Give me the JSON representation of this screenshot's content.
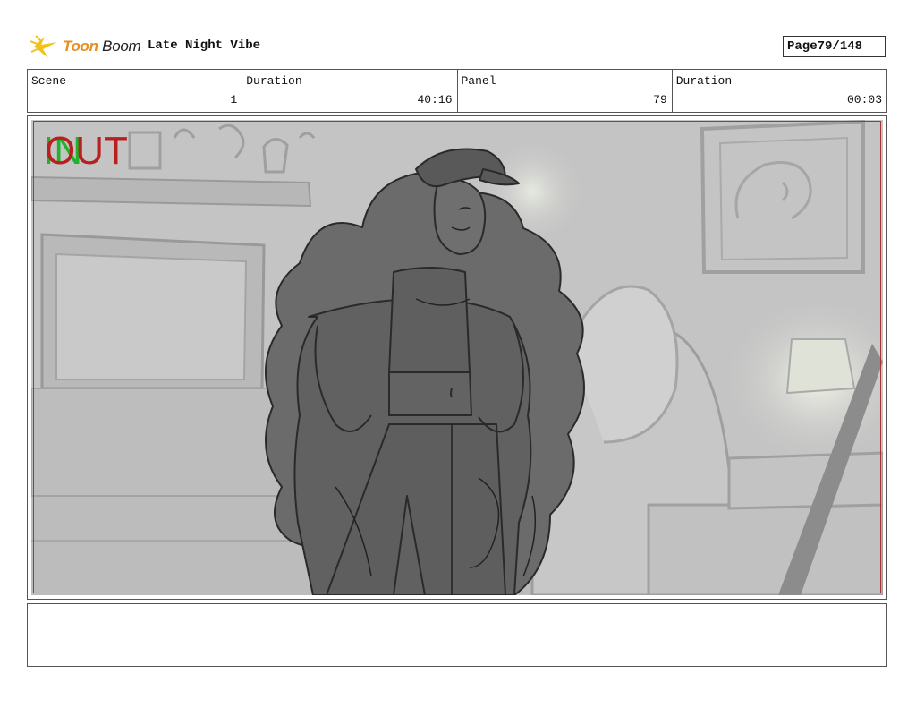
{
  "header": {
    "logo_text_accent": "Toon",
    "logo_text_rest": "Boom",
    "project_title": "Late Night Vibe",
    "page_label": "Page",
    "page_value": "79/148"
  },
  "info": {
    "scene_label": "Scene",
    "scene_value": "1",
    "duration_label": "Duration",
    "duration_value": "40:16",
    "panel_label": "Panel",
    "panel_value": "79",
    "panel_duration_label": "Duration",
    "panel_duration_value": "00:03"
  },
  "panel": {
    "in_marker": "IN",
    "out_marker": "OUT"
  },
  "colors": {
    "in_marker": "#1db32b",
    "out_marker": "#b81f1f",
    "logo_accent": "#e98e1c",
    "safe_frame": "#aa3333"
  },
  "notes": {
    "text": ""
  }
}
